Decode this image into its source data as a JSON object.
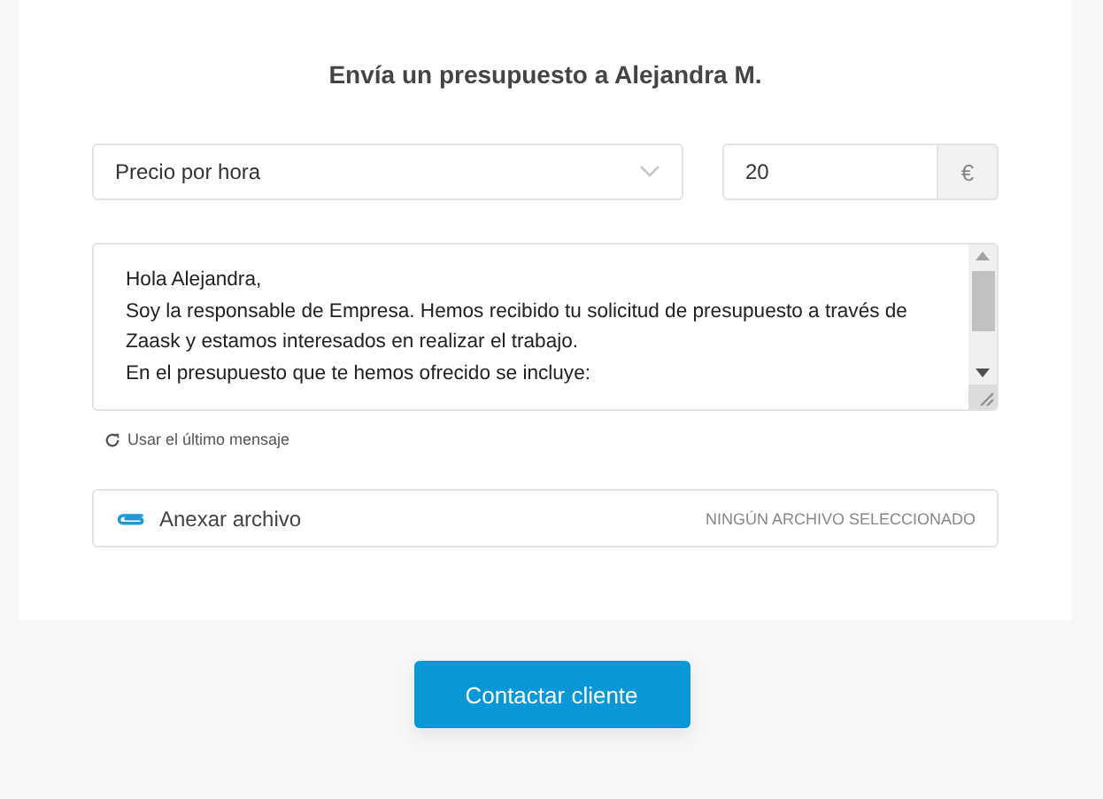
{
  "title": "Envía un presupuesto a Alejandra M.",
  "price_type": {
    "value": "Precio por hora"
  },
  "amount": {
    "value": "20",
    "currency": "€"
  },
  "message": {
    "lines": [
      "Hola Alejandra,",
      "Soy la responsable de Empresa. Hemos recibido tu solicitud de presupuesto a través de",
      "Zaask y estamos interesados en realizar el trabajo.",
      "En el presupuesto que te hemos ofrecido se incluye:"
    ]
  },
  "reuse_link": "Usar el último mensaje",
  "attachment": {
    "label": "Anexar archivo",
    "status": "NINGÚN ARCHIVO SELECCIONADO"
  },
  "submit_button": "Contactar cliente"
}
